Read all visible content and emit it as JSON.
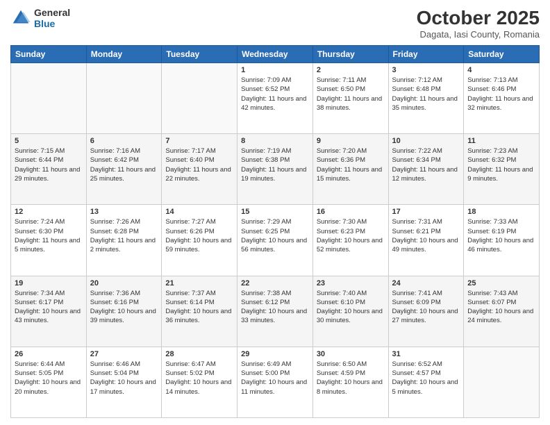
{
  "header": {
    "logo": {
      "general": "General",
      "blue": "Blue"
    },
    "title": "October 2025",
    "subtitle": "Dagata, Iasi County, Romania"
  },
  "days_of_week": [
    "Sunday",
    "Monday",
    "Tuesday",
    "Wednesday",
    "Thursday",
    "Friday",
    "Saturday"
  ],
  "weeks": [
    [
      {
        "day": "",
        "info": ""
      },
      {
        "day": "",
        "info": ""
      },
      {
        "day": "",
        "info": ""
      },
      {
        "day": "1",
        "info": "Sunrise: 7:09 AM\nSunset: 6:52 PM\nDaylight: 11 hours and 42 minutes."
      },
      {
        "day": "2",
        "info": "Sunrise: 7:11 AM\nSunset: 6:50 PM\nDaylight: 11 hours and 38 minutes."
      },
      {
        "day": "3",
        "info": "Sunrise: 7:12 AM\nSunset: 6:48 PM\nDaylight: 11 hours and 35 minutes."
      },
      {
        "day": "4",
        "info": "Sunrise: 7:13 AM\nSunset: 6:46 PM\nDaylight: 11 hours and 32 minutes."
      }
    ],
    [
      {
        "day": "5",
        "info": "Sunrise: 7:15 AM\nSunset: 6:44 PM\nDaylight: 11 hours and 29 minutes."
      },
      {
        "day": "6",
        "info": "Sunrise: 7:16 AM\nSunset: 6:42 PM\nDaylight: 11 hours and 25 minutes."
      },
      {
        "day": "7",
        "info": "Sunrise: 7:17 AM\nSunset: 6:40 PM\nDaylight: 11 hours and 22 minutes."
      },
      {
        "day": "8",
        "info": "Sunrise: 7:19 AM\nSunset: 6:38 PM\nDaylight: 11 hours and 19 minutes."
      },
      {
        "day": "9",
        "info": "Sunrise: 7:20 AM\nSunset: 6:36 PM\nDaylight: 11 hours and 15 minutes."
      },
      {
        "day": "10",
        "info": "Sunrise: 7:22 AM\nSunset: 6:34 PM\nDaylight: 11 hours and 12 minutes."
      },
      {
        "day": "11",
        "info": "Sunrise: 7:23 AM\nSunset: 6:32 PM\nDaylight: 11 hours and 9 minutes."
      }
    ],
    [
      {
        "day": "12",
        "info": "Sunrise: 7:24 AM\nSunset: 6:30 PM\nDaylight: 11 hours and 5 minutes."
      },
      {
        "day": "13",
        "info": "Sunrise: 7:26 AM\nSunset: 6:28 PM\nDaylight: 11 hours and 2 minutes."
      },
      {
        "day": "14",
        "info": "Sunrise: 7:27 AM\nSunset: 6:26 PM\nDaylight: 10 hours and 59 minutes."
      },
      {
        "day": "15",
        "info": "Sunrise: 7:29 AM\nSunset: 6:25 PM\nDaylight: 10 hours and 56 minutes."
      },
      {
        "day": "16",
        "info": "Sunrise: 7:30 AM\nSunset: 6:23 PM\nDaylight: 10 hours and 52 minutes."
      },
      {
        "day": "17",
        "info": "Sunrise: 7:31 AM\nSunset: 6:21 PM\nDaylight: 10 hours and 49 minutes."
      },
      {
        "day": "18",
        "info": "Sunrise: 7:33 AM\nSunset: 6:19 PM\nDaylight: 10 hours and 46 minutes."
      }
    ],
    [
      {
        "day": "19",
        "info": "Sunrise: 7:34 AM\nSunset: 6:17 PM\nDaylight: 10 hours and 43 minutes."
      },
      {
        "day": "20",
        "info": "Sunrise: 7:36 AM\nSunset: 6:16 PM\nDaylight: 10 hours and 39 minutes."
      },
      {
        "day": "21",
        "info": "Sunrise: 7:37 AM\nSunset: 6:14 PM\nDaylight: 10 hours and 36 minutes."
      },
      {
        "day": "22",
        "info": "Sunrise: 7:38 AM\nSunset: 6:12 PM\nDaylight: 10 hours and 33 minutes."
      },
      {
        "day": "23",
        "info": "Sunrise: 7:40 AM\nSunset: 6:10 PM\nDaylight: 10 hours and 30 minutes."
      },
      {
        "day": "24",
        "info": "Sunrise: 7:41 AM\nSunset: 6:09 PM\nDaylight: 10 hours and 27 minutes."
      },
      {
        "day": "25",
        "info": "Sunrise: 7:43 AM\nSunset: 6:07 PM\nDaylight: 10 hours and 24 minutes."
      }
    ],
    [
      {
        "day": "26",
        "info": "Sunrise: 6:44 AM\nSunset: 5:05 PM\nDaylight: 10 hours and 20 minutes."
      },
      {
        "day": "27",
        "info": "Sunrise: 6:46 AM\nSunset: 5:04 PM\nDaylight: 10 hours and 17 minutes."
      },
      {
        "day": "28",
        "info": "Sunrise: 6:47 AM\nSunset: 5:02 PM\nDaylight: 10 hours and 14 minutes."
      },
      {
        "day": "29",
        "info": "Sunrise: 6:49 AM\nSunset: 5:00 PM\nDaylight: 10 hours and 11 minutes."
      },
      {
        "day": "30",
        "info": "Sunrise: 6:50 AM\nSunset: 4:59 PM\nDaylight: 10 hours and 8 minutes."
      },
      {
        "day": "31",
        "info": "Sunrise: 6:52 AM\nSunset: 4:57 PM\nDaylight: 10 hours and 5 minutes."
      },
      {
        "day": "",
        "info": ""
      }
    ]
  ]
}
